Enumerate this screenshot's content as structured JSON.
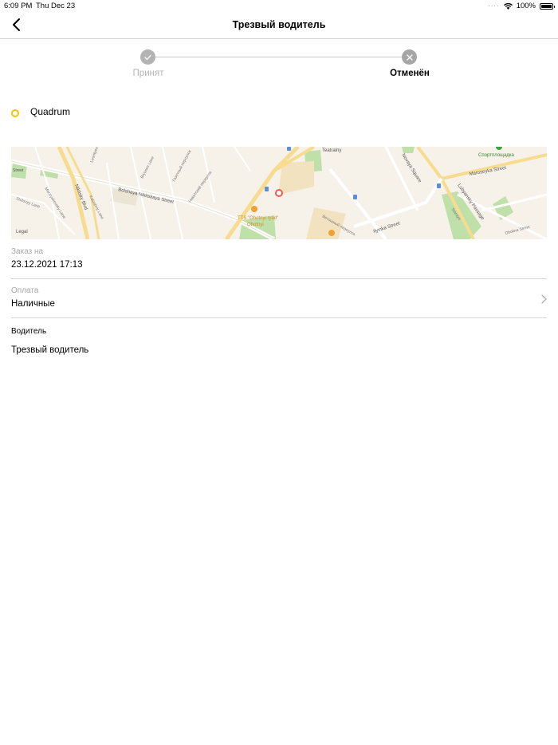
{
  "status_bar": {
    "time": "6:09 PM",
    "date": "Thu Dec 23",
    "battery": "100%"
  },
  "nav": {
    "title": "Трезвый водитель",
    "back_icon": "chevron-left-icon"
  },
  "stepper": {
    "steps": [
      {
        "label": "Принят",
        "icon": "check-icon",
        "active": false
      },
      {
        "label": "Отменён",
        "icon": "close-icon",
        "active": true
      }
    ]
  },
  "route": {
    "point": "Quadrum",
    "point_color": "#f2c500"
  },
  "map": {
    "labels": {
      "street_1": "Bolshaya Nikitskaya Street",
      "street_2": "Nikitsky Blvd",
      "street_3": "Novaya Square",
      "street_4": "Maroseyka Street",
      "street_5": "Ilyinka Street",
      "street_6": "Lubyansky Passage",
      "street_7": "Teatralny",
      "poi_1": "Спортплощадка",
      "poi_2": "TTS \"Ohotnyi ryad\"",
      "legal": "Legal",
      "small_1": "Stolovyy Lane",
      "small_2": "Merzlyakovsky Lane",
      "small_3": "Kalashny Lane",
      "small_4": "Bryusov Lane",
      "small_5": "Газетный переулок",
      "small_6": "Никитский переулок",
      "small_7": "Ветошный переулок",
      "small_8": "Leontyevsky",
      "small_9": "Street",
      "small_10": "Ohotnyi",
      "small_11": "Obolina Street",
      "small_12": "Staraya"
    },
    "marker_color": "#f05a4f"
  },
  "order": {
    "label": "Заказ на",
    "value": "23.12.2021 17:13"
  },
  "payment": {
    "label": "Оплата",
    "value": "Наличные"
  },
  "driver": {
    "title": "Водитель",
    "value": "Трезвый водитель"
  }
}
